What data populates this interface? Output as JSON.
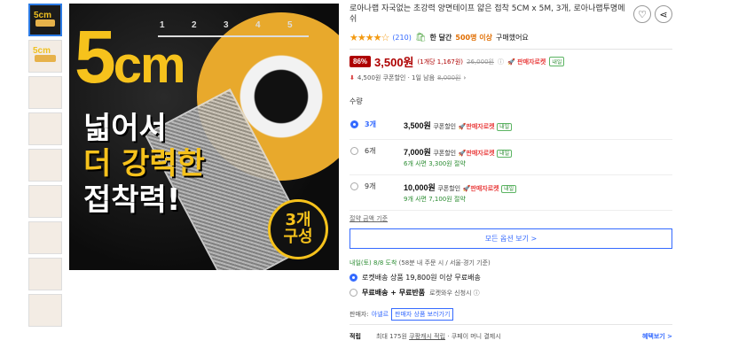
{
  "product": {
    "title": "로아나랩 자국없는 초강력 양면테이프 얇은 접착 5CM x 5M, 3개, 로아나랩투명메쉬",
    "rating_stars": "★★★★☆",
    "review_count": "(210)",
    "purchase_prefix": "한 달간",
    "purchase_count": "500명 이상",
    "purchase_suffix": "구매했어요",
    "discount": "86%",
    "price": "3,500원",
    "unit_price": "(1개당 1,167원)",
    "original_price": "26,000원",
    "rocket_label": "판매자로켓",
    "rocket_tag": "내일",
    "coupon_text": "4,500원 쿠폰할인 · 1일 남음",
    "coupon_original": "8,000원"
  },
  "hero": {
    "size_text": "5",
    "size_unit": "cm",
    "ruler": [
      "1",
      "2",
      "3",
      "4",
      "5"
    ],
    "line1": "넓어서",
    "line2": "더 강력한",
    "line3": "접착력!",
    "badge_line1": "3개",
    "badge_line2": "구성"
  },
  "thumbnails": [
    "5cm",
    "5cm",
    "",
    "",
    "",
    "",
    "",
    "",
    ""
  ],
  "qty_label": "수량",
  "options": [
    {
      "name": "3개",
      "price": "3,500원",
      "coupon": "쿠폰할인",
      "rocket": "판매자로켓",
      "tag": "내일",
      "save": "",
      "selected": true
    },
    {
      "name": "6개",
      "price": "7,000원",
      "coupon": "쿠폰할인",
      "rocket": "판매자로켓",
      "tag": "내일",
      "save": "6개 사면 3,300원 절약",
      "selected": false
    },
    {
      "name": "9개",
      "price": "10,000원",
      "coupon": "쿠폰할인",
      "rocket": "판매자로켓",
      "tag": "내일",
      "save": "9개 사면 7,100원 절약",
      "selected": false
    }
  ],
  "save_criteria": "절약 금액 기준",
  "all_options_button": "모든 옵션 보기 >",
  "delivery": {
    "arrive": "내일(토) 8/8 도착",
    "condition": "(58분 내 주문 시 / 서울·경기 기준)",
    "rocket_shipping": "로켓배송 상품 19,800원 이상 무료배송",
    "free_shipping": "무료배송 + 무료반품",
    "free_sub": "로켓와우 신청시 ⓘ"
  },
  "seller": {
    "label": "판매자:",
    "name": "아넬르",
    "button": "판매자 상품 보러가기"
  },
  "points": {
    "label": "적립",
    "text": "최대 175원",
    "cash": "쿠팡캐시 적립",
    "pay": "· 쿠페이 머니 결제시",
    "benefit": "혜택보기 >"
  },
  "icons": {
    "heart": "heart-icon",
    "share": "share-icon"
  }
}
